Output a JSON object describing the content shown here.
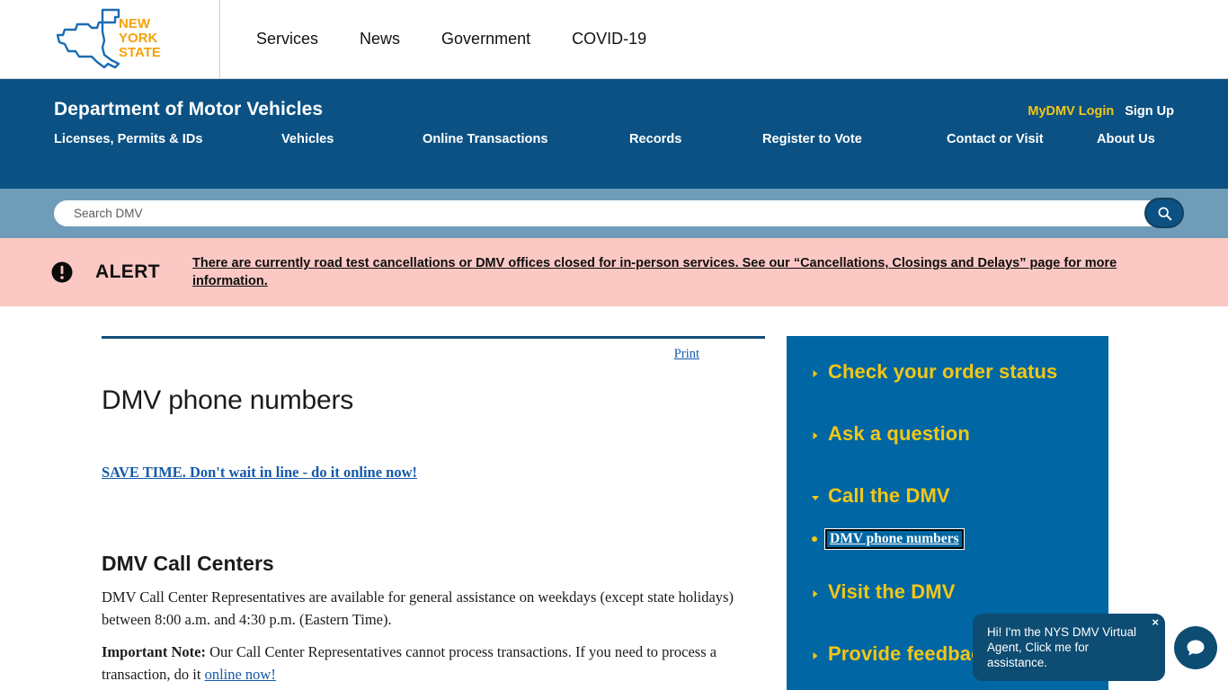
{
  "statewide_bar": {
    "logo_alt": "New York State",
    "logo_lines": [
      "NEW",
      "YORK",
      "STATE"
    ],
    "links": [
      {
        "label": "Services"
      },
      {
        "label": "News"
      },
      {
        "label": "Government"
      },
      {
        "label": "COVID-19"
      }
    ]
  },
  "dmv_header": {
    "agency_title": "Department of Motor Vehicles",
    "account": {
      "login_label": "MyDMV Login",
      "signup_label": "Sign Up"
    },
    "nav": [
      {
        "label": "Licenses, Permits & IDs"
      },
      {
        "label": "Vehicles"
      },
      {
        "label": "Online Transactions"
      },
      {
        "label": "Records"
      },
      {
        "label": "Register to Vote"
      },
      {
        "label": "Contact or Visit"
      },
      {
        "label": "About Us"
      }
    ]
  },
  "search": {
    "placeholder": "Search DMV",
    "value": "",
    "button_icon": "search-icon"
  },
  "alert": {
    "icon": "exclamation-circle-icon",
    "label": "ALERT",
    "message": "There are currently road test cancellations or DMV offices closed for in-person services. See our “Cancellations, Closings and Delays” page for more information."
  },
  "main": {
    "print_label": "Print",
    "title": "DMV phone numbers",
    "save_time_link": "SAVE TIME.  Don't wait in line - do it online now!",
    "section_heading": "DMV Call Centers",
    "paragraph_1": "DMV Call Center Representatives are available for general assistance on weekdays (except state holidays) between 8:00 a.m. and 4:30 p.m. (Eastern Time).",
    "paragraph_2_bold": "Important Note:",
    "paragraph_2_text": " Our Call Center Representatives cannot process transactions.  If you need to process a transaction, do it ",
    "paragraph_2_link": "online now!"
  },
  "sidebar": {
    "items": [
      {
        "label": "Check your order status",
        "expanded": false
      },
      {
        "label": "Ask a question",
        "expanded": false
      },
      {
        "label": "Call the DMV",
        "expanded": true
      },
      {
        "label": "Visit the DMV",
        "expanded": false
      },
      {
        "label": "Provide feedback",
        "expanded": false
      }
    ],
    "sub_items": [
      {
        "label": "DMV phone numbers",
        "active": true
      }
    ]
  },
  "chat": {
    "tooltip": "Hi! I'm the NYS DMV Virtual Agent, Click me for assistance.",
    "close_label": "×",
    "fab_icon": "chat-bubble-icon"
  },
  "colors": {
    "nys_blue": "#1b6cb2",
    "nys_orange": "#f2a20c",
    "header_blue": "#0b5183",
    "sidebar_blue": "#0066a4",
    "search_band": "#6f9cb8",
    "alert_pink": "#fbc8c4",
    "accent_gold": "#f2c716",
    "link_blue": "#1559a8",
    "chat_navy": "#0d4c73"
  }
}
